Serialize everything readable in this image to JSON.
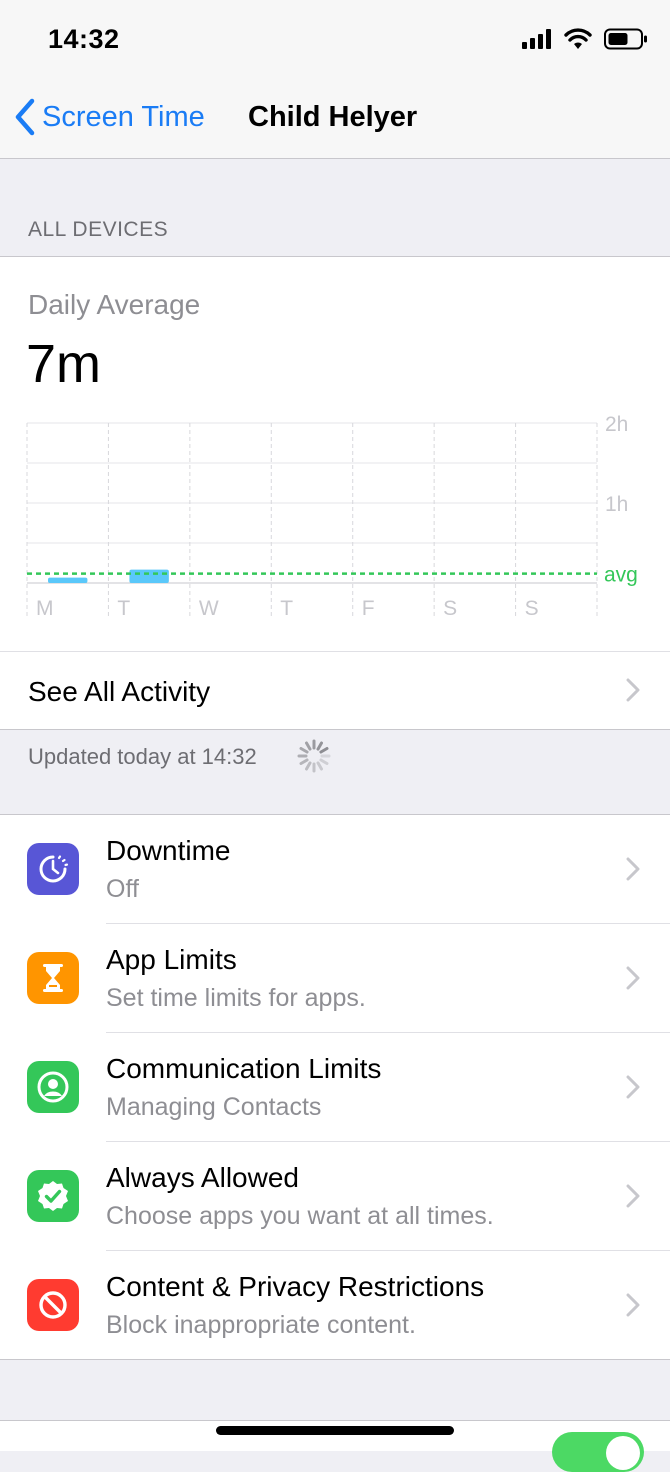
{
  "status_bar": {
    "time": "14:32"
  },
  "nav": {
    "back_label": "Screen Time",
    "title": "Child Helyer"
  },
  "section_header": "ALL DEVICES",
  "summary": {
    "label": "Daily Average",
    "value": "7m"
  },
  "chart_data": {
    "type": "bar",
    "categories": [
      "M",
      "T",
      "W",
      "T",
      "F",
      "S",
      "S"
    ],
    "values": [
      4,
      10,
      0,
      0,
      0,
      0,
      0
    ],
    "y_tick_labels": [
      "2h",
      "1h"
    ],
    "ylim": [
      0,
      120
    ],
    "avg_label": "avg",
    "avg_value": 7,
    "bar_color": "#5ac8fa",
    "avg_color": "#34c759"
  },
  "see_all_label": "See All Activity",
  "updated_text": "Updated today at 14:32",
  "list": [
    {
      "title": "Downtime",
      "subtitle": "Off",
      "icon": "downtime-icon",
      "color": "#5856d6"
    },
    {
      "title": "App Limits",
      "subtitle": "Set time limits for apps.",
      "icon": "hourglass-icon",
      "color": "#ff9500"
    },
    {
      "title": "Communication Limits",
      "subtitle": "Managing Contacts",
      "icon": "person-circle-icon",
      "color": "#34c759"
    },
    {
      "title": "Always Allowed",
      "subtitle": "Choose apps you want at all times.",
      "icon": "checkmark-seal-icon",
      "color": "#34c759"
    },
    {
      "title": "Content & Privacy Restrictions",
      "subtitle": "Block inappropriate content.",
      "icon": "no-entry-icon",
      "color": "#ff3b30"
    }
  ],
  "colors": {
    "accent": "#1a7cf5",
    "toggle_on": "#4cd964"
  }
}
